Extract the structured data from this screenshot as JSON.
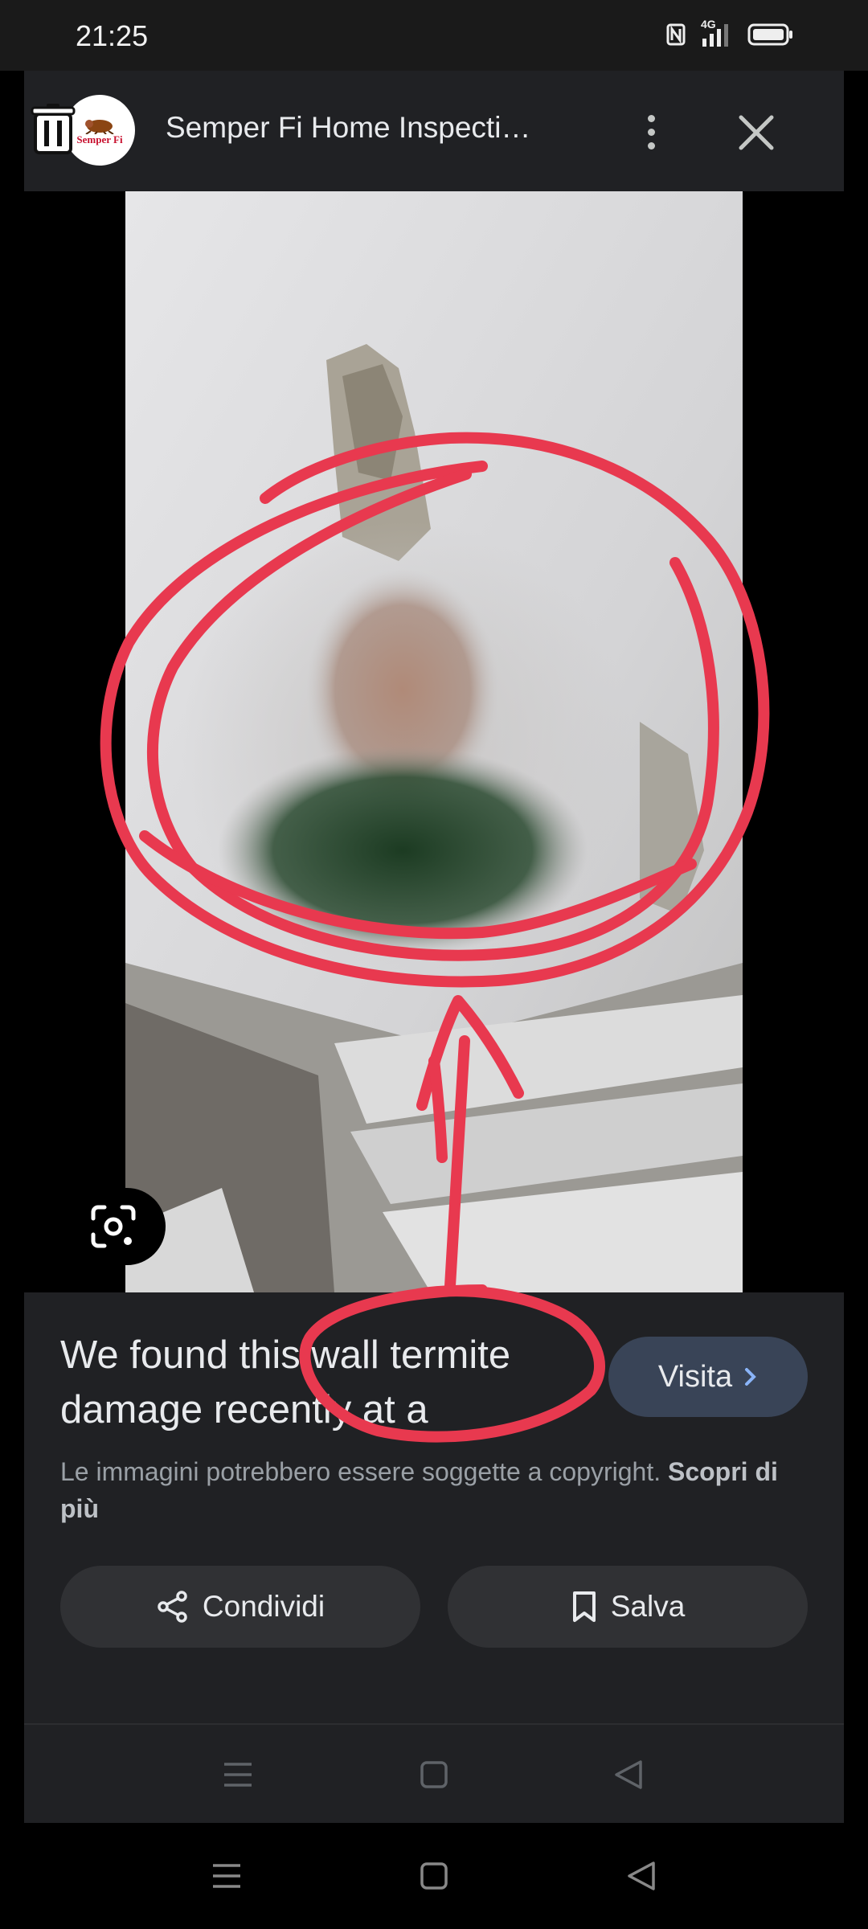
{
  "status_bar": {
    "time": "21:25",
    "icons": [
      "nfc-icon",
      "signal-4g-icon",
      "battery-icon"
    ],
    "network_label": "4G"
  },
  "header": {
    "logo_text": "Semper Fi",
    "title": "Semper Fi Home Inspecti…",
    "icons": [
      "trash-icon",
      "more-vert-icon",
      "close-icon"
    ]
  },
  "image": {
    "lens_icon": "google-lens-icon"
  },
  "info": {
    "caption": "We found this wall termite damage recently at a",
    "visit_label": "Visita",
    "copyright_text": "Le immagini potrebbero essere soggette a copyright.",
    "learn_more_label": "Scopri di più",
    "share_label": "Condividi",
    "save_label": "Salva"
  },
  "navigation": {
    "icons": [
      "menu-nav-icon",
      "home-nav-icon",
      "back-nav-icon"
    ]
  },
  "colors": {
    "annotation": "#e8394f",
    "sheet_background": "#202124",
    "visit_button": "#394457"
  }
}
